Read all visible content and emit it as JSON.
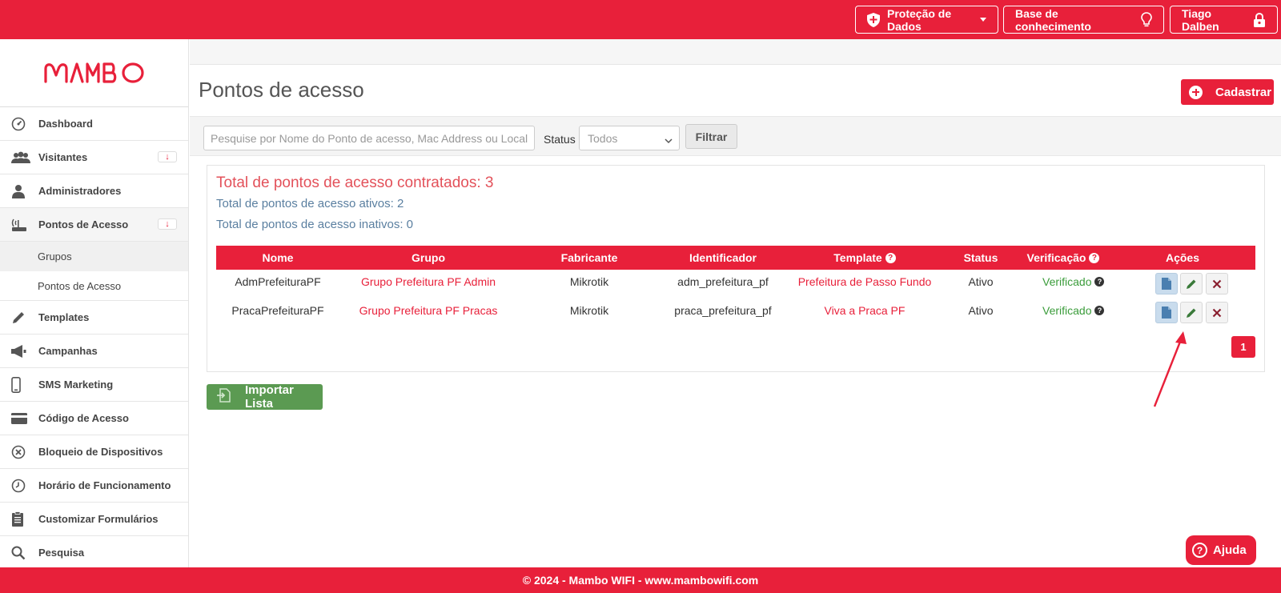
{
  "topbar": {
    "protecao_label": "Proteção de Dados",
    "base_label": "Base de conhecimento",
    "user_label": "Tiago Dalben",
    "accent": "#e8203a"
  },
  "sidebar": {
    "logo_text": "MAMBO",
    "items": [
      {
        "label": "Dashboard",
        "icon": "dashboard-icon"
      },
      {
        "label": "Visitantes",
        "icon": "users-icon",
        "badge": "↓"
      },
      {
        "label": "Administradores",
        "icon": "user-icon"
      },
      {
        "label": "Pontos de Acesso",
        "icon": "router-icon",
        "badge": "↓"
      },
      {
        "label": "Templates",
        "icon": "pencil-icon"
      },
      {
        "label": "Campanhas",
        "icon": "megaphone-icon"
      },
      {
        "label": "SMS Marketing",
        "icon": "phone-icon"
      },
      {
        "label": "Código de Acesso",
        "icon": "card-icon"
      },
      {
        "label": "Bloqueio de Dispositivos",
        "icon": "block-icon"
      },
      {
        "label": "Horário de Funcionamento",
        "icon": "clock-icon"
      },
      {
        "label": "Customizar Formulários",
        "icon": "clipboard-icon"
      },
      {
        "label": "Pesquisa",
        "icon": "search-icon"
      }
    ],
    "subitems": [
      {
        "label": "Grupos"
      },
      {
        "label": "Pontos de Acesso"
      }
    ]
  },
  "main": {
    "title": "Pontos de acesso",
    "cadastrar_label": "Cadastrar",
    "search_placeholder": "Pesquise por Nome do Ponto de acesso, Mac Address ou Local",
    "status_label": "Status",
    "status_value": "Todos",
    "filtrar_label": "Filtrar",
    "total_contratados": "Total de pontos de acesso contratados: 3",
    "total_ativos": "Total de pontos de acesso ativos: 2",
    "total_inativos": "Total de pontos de acesso inativos: 0",
    "importar_label": "Importar Lista",
    "page_number": "1"
  },
  "table": {
    "headers": [
      "Nome",
      "Grupo",
      "Fabricante",
      "Identificador",
      "Template",
      "Status",
      "Verificação",
      "Ações"
    ],
    "rows": [
      {
        "nome": "AdmPrefeituraPF",
        "grupo": "Grupo Prefeitura PF Admin",
        "fabricante": "Mikrotik",
        "identificador": "adm_prefeitura_pf",
        "template": "Prefeitura de Passo Fundo",
        "status": "Ativo",
        "verificacao": "Verificado"
      },
      {
        "nome": "PracaPrefeituraPF",
        "grupo": "Grupo Prefeitura PF Pracas",
        "fabricante": "Mikrotik",
        "identificador": "praca_prefeitura_pf",
        "template": "Viva a Praca PF",
        "status": "Ativo",
        "verificacao": "Verificado"
      }
    ]
  },
  "help": {
    "label": "Ajuda"
  },
  "footer": {
    "text": "© 2024 - Mambo WIFI - www.mambowifi.com"
  }
}
